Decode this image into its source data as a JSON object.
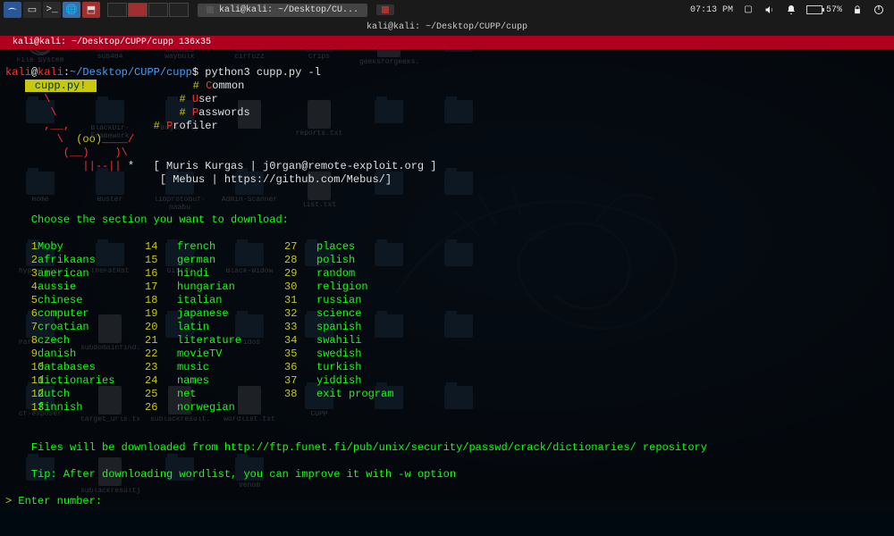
{
  "taskbar": {
    "task1": "kali@kali: ~/Desktop/CU...",
    "time": "07:13 PM",
    "battery_pct": "57%"
  },
  "desktop_icons": [
    {
      "type": "fsys",
      "label": "File System"
    },
    {
      "type": "folder",
      "label": "sub404"
    },
    {
      "type": "folder",
      "label": "waybulk"
    },
    {
      "type": "folder",
      "label": "cirfuzz"
    },
    {
      "type": "folder",
      "label": "Crips"
    },
    {
      "type": "file",
      "label": "geeksforgeeks.txt"
    },
    {
      "type": "folder",
      "label": ""
    },
    {
      "type": "folder",
      "label": ""
    },
    {
      "type": "folder",
      "label": "BlackDir-Framework"
    },
    {
      "type": "folder",
      "label": "BugBounty"
    },
    {
      "type": "file",
      "label": ""
    },
    {
      "type": "file",
      "label": "reports.txt"
    },
    {
      "type": "folder",
      "label": ""
    },
    {
      "type": "folder",
      "label": ""
    },
    {
      "type": "folder",
      "label": "Home"
    },
    {
      "type": "folder",
      "label": "Buster"
    },
    {
      "type": "folder",
      "label": "libprotobuf-naabu"
    },
    {
      "type": "folder",
      "label": "Admin-Scanner"
    },
    {
      "type": "file",
      "label": "list.txt"
    },
    {
      "type": "folder",
      "label": ""
    },
    {
      "type": "folder",
      "label": ""
    },
    {
      "type": "folder",
      "label": "hypdofiles"
    },
    {
      "type": "folder",
      "label": "TheFatRat"
    },
    {
      "type": "folder",
      "label": "Gitlab"
    },
    {
      "type": "folder",
      "label": "Black-Widow"
    },
    {
      "type": "folder",
      "label": ""
    },
    {
      "type": "folder",
      "label": ""
    },
    {
      "type": "folder",
      "label": ""
    },
    {
      "type": "folder",
      "label": "Parsfinder"
    },
    {
      "type": "file",
      "label": "subdomainfind.txt"
    },
    {
      "type": "folder",
      "label": ""
    },
    {
      "type": "folder",
      "label": "Tidos"
    },
    {
      "type": "folder",
      "label": ""
    },
    {
      "type": "folder",
      "label": ""
    },
    {
      "type": "folder",
      "label": ""
    },
    {
      "type": "folder",
      "label": "cf-exposer"
    },
    {
      "type": "file",
      "label": "target_urls.txt"
    },
    {
      "type": "file",
      "label": "sublackresult.txt"
    },
    {
      "type": "file",
      "label": "wordlist.txt"
    },
    {
      "type": "folder",
      "label": "CUPP"
    },
    {
      "type": "folder",
      "label": ""
    },
    {
      "type": "folder",
      "label": ""
    },
    {
      "type": "folder",
      "label": ""
    },
    {
      "type": "file",
      "label": "sublackresultjson.json"
    },
    {
      "type": "folder",
      "label": ""
    },
    {
      "type": "folder",
      "label": "Venom"
    }
  ],
  "terminal": {
    "title": "kali@kali: ~/Desktop/CUPP/cupp",
    "tab": "kali@kali: ~/Desktop/CUPP/cupp 136x35",
    "prompt_user": "kali",
    "prompt_at": "@",
    "prompt_host": "kali",
    "prompt_sep1": ":",
    "prompt_path": "~/Desktop/CUPP/cupp",
    "prompt_dollar": "$",
    "command": " python3 cupp.py -l",
    "banner_label": " cupp.py! ",
    "banner_c": "C",
    "banner_common": "ommon",
    "banner_u": "U",
    "banner_user": "ser",
    "banner_p": "P",
    "banner_passwords": "asswords",
    "banner_p2": "P",
    "banner_profiler": "rofiler",
    "ascii_l2_pre": "      ",
    "ascii_l2_oo": "(oo)",
    "ascii_l2_post": "____/ ",
    "ascii_l3": "         (__)    )\\  ",
    "ascii_l4_pre": "            ||--|| ",
    "ascii_l4_star": "* ",
    "author1_a": "[ Muris Kurgas | j0rgan",
    "author1_b": "@",
    "author1_c": "remote-exploit.org ]",
    "author2": "[ Mebus | https://github.com/Mebus/]",
    "section_heading": "    Choose the section you want to download:",
    "items": [
      {
        "n": "1",
        "a": "Moby",
        "m": "14",
        "b": "french",
        "r": "27",
        "c": "places"
      },
      {
        "n": "2",
        "a": "afrikaans",
        "m": "15",
        "b": "german",
        "r": "28",
        "c": "polish"
      },
      {
        "n": "3",
        "a": "american",
        "m": "16",
        "b": "hindi",
        "r": "29",
        "c": "random"
      },
      {
        "n": "4",
        "a": "aussie",
        "m": "17",
        "b": "hungarian",
        "r": "30",
        "c": "religion"
      },
      {
        "n": "5",
        "a": "chinese",
        "m": "18",
        "b": "italian",
        "r": "31",
        "c": "russian"
      },
      {
        "n": "6",
        "a": "computer",
        "m": "19",
        "b": "japanese",
        "r": "32",
        "c": "science"
      },
      {
        "n": "7",
        "a": "croatian",
        "m": "20",
        "b": "latin",
        "r": "33",
        "c": "spanish"
      },
      {
        "n": "8",
        "a": "czech",
        "m": "21",
        "b": "literature",
        "r": "34",
        "c": "swahili"
      },
      {
        "n": "9",
        "a": "danish",
        "m": "22",
        "b": "movieTV",
        "r": "35",
        "c": "swedish"
      },
      {
        "n": "10",
        "a": "databases",
        "m": "23",
        "b": "music",
        "r": "36",
        "c": "turkish"
      },
      {
        "n": "11",
        "a": "dictionaries",
        "m": "24",
        "b": "names",
        "r": "37",
        "c": "yiddish"
      },
      {
        "n": "12",
        "a": "dutch",
        "m": "25",
        "b": "net",
        "r": "38",
        "c": "exit program"
      },
      {
        "n": "13",
        "a": "finnish",
        "m": "26",
        "b": "norwegian",
        "r": "",
        "c": ""
      }
    ],
    "footer1": "    Files will be downloaded from http://ftp.funet.fi/pub/unix/security/passwd/crack/dictionaries/ repository",
    "footer2": "    Tip: After downloading wordlist, you can improve it with -w option",
    "prompt2_gt": ">",
    "prompt2_text": " Enter number:"
  }
}
